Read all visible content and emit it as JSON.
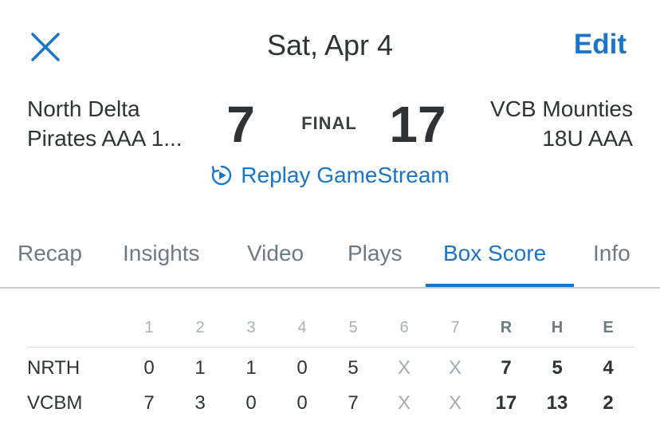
{
  "header": {
    "close_icon": "close-icon",
    "title": "Sat, Apr 4",
    "edit_label": "Edit"
  },
  "game": {
    "away_team_line1": "North Delta",
    "away_team_line2": "Pirates AAA 1...",
    "away_score": "7",
    "status": "FINAL",
    "home_score": "17",
    "home_team_line1": "VCB Mounties",
    "home_team_line2": "18U AAA",
    "replay_icon": "replay-icon",
    "replay_label": "Replay GameStream"
  },
  "tabs": [
    {
      "label": "Recap"
    },
    {
      "label": "Insights"
    },
    {
      "label": "Video"
    },
    {
      "label": "Plays"
    },
    {
      "label": "Box Score",
      "active": true
    },
    {
      "label": "Info"
    }
  ],
  "box_score": {
    "headers": [
      "1",
      "2",
      "3",
      "4",
      "5",
      "6",
      "7",
      "R",
      "H",
      "E"
    ],
    "rows": [
      {
        "team": "NRTH",
        "cells": [
          "0",
          "1",
          "1",
          "0",
          "5",
          "X",
          "X",
          "7",
          "5",
          "4"
        ]
      },
      {
        "team": "VCBM",
        "cells": [
          "7",
          "3",
          "0",
          "0",
          "7",
          "X",
          "X",
          "17",
          "13",
          "2"
        ]
      }
    ]
  },
  "colors": {
    "accent": "#1a75c9",
    "text": "#2e3338",
    "muted": "#6c7a86",
    "faint": "#a7b1b9"
  }
}
